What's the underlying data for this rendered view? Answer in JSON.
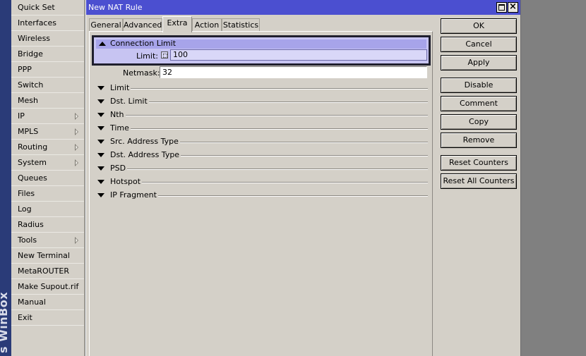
{
  "app": {
    "vertical_label": "s WinBox"
  },
  "sidebar": {
    "items": [
      {
        "label": "Quick Set",
        "submenu": false
      },
      {
        "label": "Interfaces",
        "submenu": false
      },
      {
        "label": "Wireless",
        "submenu": false
      },
      {
        "label": "Bridge",
        "submenu": false
      },
      {
        "label": "PPP",
        "submenu": false
      },
      {
        "label": "Switch",
        "submenu": false
      },
      {
        "label": "Mesh",
        "submenu": false
      },
      {
        "label": "IP",
        "submenu": true
      },
      {
        "label": "MPLS",
        "submenu": true
      },
      {
        "label": "Routing",
        "submenu": true
      },
      {
        "label": "System",
        "submenu": true
      },
      {
        "label": "Queues",
        "submenu": false
      },
      {
        "label": "Files",
        "submenu": false
      },
      {
        "label": "Log",
        "submenu": false
      },
      {
        "label": "Radius",
        "submenu": false
      },
      {
        "label": "Tools",
        "submenu": true
      },
      {
        "label": "New Terminal",
        "submenu": false
      },
      {
        "label": "MetaROUTER",
        "submenu": false
      },
      {
        "label": "Make Supout.rif",
        "submenu": false
      },
      {
        "label": "Manual",
        "submenu": false
      },
      {
        "label": "Exit",
        "submenu": false
      }
    ]
  },
  "window": {
    "title": "New NAT Rule",
    "tabs": [
      {
        "label": "General",
        "active": false
      },
      {
        "label": "Advanced",
        "active": false
      },
      {
        "label": "Extra",
        "active": true
      },
      {
        "label": "Action",
        "active": false
      },
      {
        "label": "Statistics",
        "active": false
      }
    ],
    "connection_limit": {
      "header": "Connection Limit",
      "limit_label": "Limit:",
      "limit_value": "100",
      "netmask_label": "Netmask:",
      "netmask_value": "32"
    },
    "collapsed_sections": [
      "Limit",
      "Dst. Limit",
      "Nth",
      "Time",
      "Src. Address Type",
      "Dst. Address Type",
      "PSD",
      "Hotspot",
      "IP Fragment"
    ],
    "buttons": {
      "ok": "OK",
      "cancel": "Cancel",
      "apply": "Apply",
      "disable": "Disable",
      "comment": "Comment",
      "copy": "Copy",
      "remove": "Remove",
      "reset_counters": "Reset Counters",
      "reset_all_counters": "Reset All Counters"
    }
  },
  "colors": {
    "titlebar": "#4b4fd0",
    "highlight_section": "#c7c4f2",
    "window_bg": "#d4d0c8",
    "sidebar_strip": "#2a3b78"
  }
}
